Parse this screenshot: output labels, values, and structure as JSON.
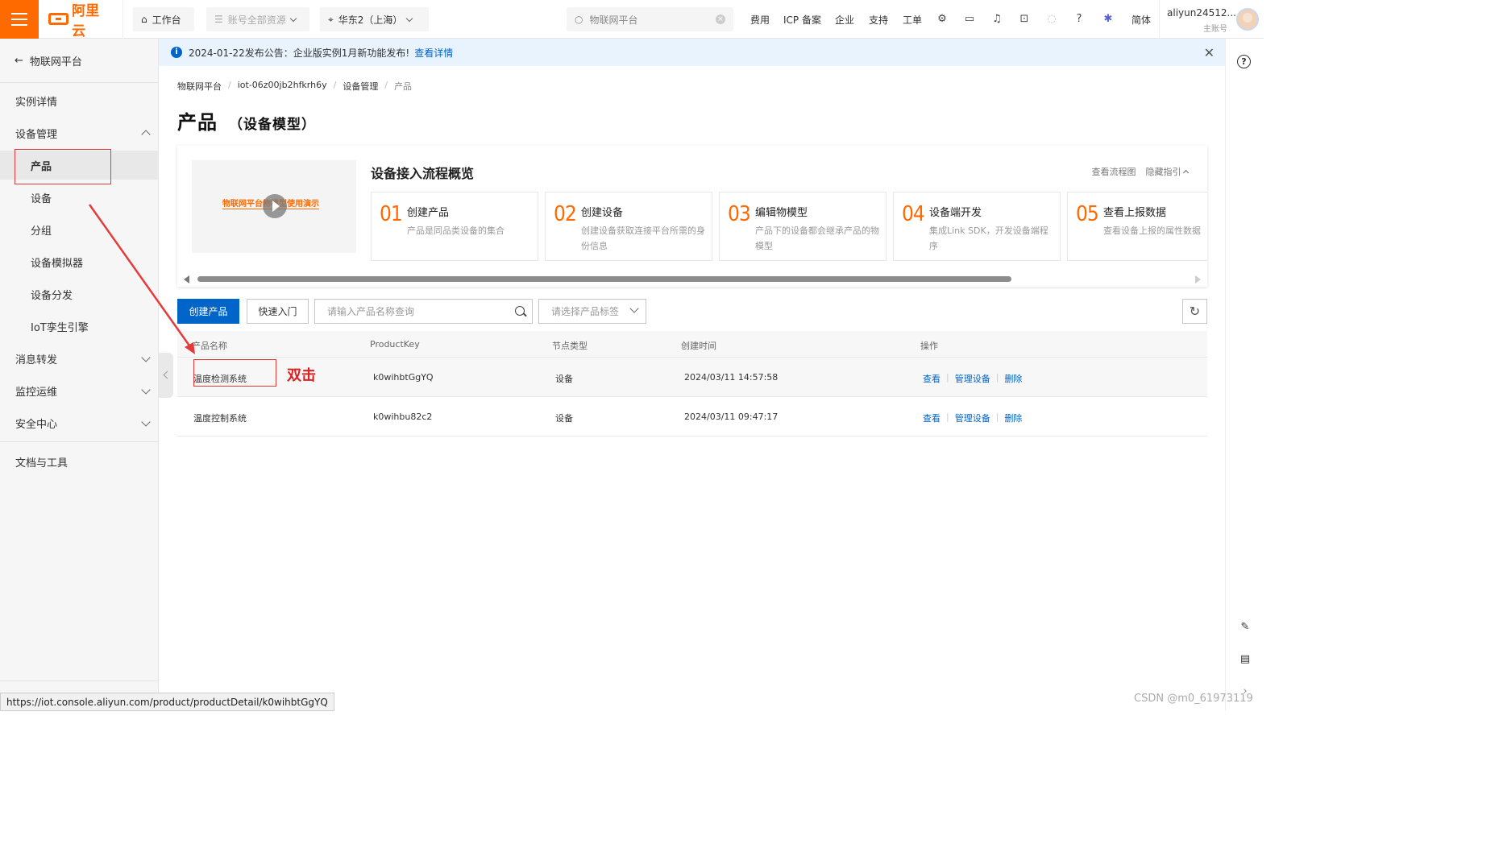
{
  "topbar": {
    "logo_text": "阿里云",
    "workbench": "工作台",
    "resources": "账号全部资源",
    "region": "华东2（上海）",
    "search_placeholder": "物联网平台",
    "nav": [
      "费用",
      "ICP 备案",
      "企业",
      "支持",
      "工单"
    ],
    "lang": "简体",
    "account_name": "aliyun24512...",
    "account_role": "主账号"
  },
  "sidebar": {
    "back_label": "物联网平台",
    "items": [
      {
        "label": "实例详情"
      },
      {
        "label": "设备管理"
      },
      {
        "label": "产品"
      },
      {
        "label": "设备"
      },
      {
        "label": "分组"
      },
      {
        "label": "设备模拟器"
      },
      {
        "label": "设备分发"
      },
      {
        "label": "IoT孪生引擎"
      },
      {
        "label": "消息转发"
      },
      {
        "label": "监控运维"
      },
      {
        "label": "安全中心"
      },
      {
        "label": "文档与工具"
      }
    ]
  },
  "notice": {
    "text": "2024-01-22发布公告：企业版实例1月新功能发布!",
    "link": "查看详情"
  },
  "breadcrumb": [
    "物联网平台",
    "iot-06z00jb2hfkrh6y",
    "设备管理",
    "产品"
  ],
  "page": {
    "title": "产品",
    "subtitle": "（设备模型）"
  },
  "guide": {
    "video_title": "物联网平台物模型使用演示",
    "title": "设备接入流程概览",
    "link_flow": "查看流程图",
    "link_hide": "隐藏指引",
    "steps": [
      {
        "num": "01",
        "title": "创建产品",
        "desc": "产品是同品类设备的集合"
      },
      {
        "num": "02",
        "title": "创建设备",
        "desc": "创建设备获取连接平台所需的身份信息"
      },
      {
        "num": "03",
        "title": "编辑物模型",
        "desc": "产品下的设备都会继承产品的物模型"
      },
      {
        "num": "04",
        "title": "设备端开发",
        "desc": "集成Link SDK，开发设备端程序"
      },
      {
        "num": "05",
        "title": "查看上报数据",
        "desc": "查看设备上报的属性数据"
      }
    ]
  },
  "toolbar": {
    "create_label": "创建产品",
    "quickstart_label": "快速入门",
    "search_placeholder": "请输入产品名称查询",
    "tag_placeholder": "请选择产品标签"
  },
  "table": {
    "columns": [
      "产品名称",
      "ProductKey",
      "节点类型",
      "创建时间",
      "操作"
    ],
    "rows": [
      {
        "name": "温度检测系统",
        "key": "k0wihbtGgYQ",
        "node": "设备",
        "created": "2024/03/11 14:57:58",
        "ops": [
          "查看",
          "管理设备",
          "删除"
        ]
      },
      {
        "name": "温度控制系统",
        "key": "k0wihbu82c2",
        "node": "设备",
        "created": "2024/03/11 09:47:17",
        "ops": [
          "查看",
          "管理设备",
          "删除"
        ]
      }
    ]
  },
  "annotation": {
    "label": "双击"
  },
  "status_url": "https://iot.console.aliyun.com/product/productDetail/k0wihbtGgYQ",
  "watermark": "CSDN @m0_61973119",
  "colors": {
    "brand": "#ff6a00",
    "primary": "#0064c8",
    "annotation": "#e53a3a"
  }
}
